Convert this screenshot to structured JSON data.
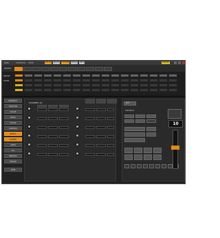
{
  "window": {
    "title": "GMA",
    "menus": [
      "CONTROL",
      "VIEW"
    ],
    "toolbar": [
      {
        "label": "SETUP",
        "active": true
      },
      {
        "label": "PATCH",
        "active": false
      },
      {
        "label": "FIXTURE",
        "active": true
      },
      {
        "label": "TOOLS",
        "active": false
      },
      {
        "label": "HELP",
        "active": false
      }
    ],
    "status": "ONLINE"
  },
  "strip": {
    "label": "PRESET",
    "tabs": [
      "1",
      "2",
      "3",
      "4",
      "5",
      "6",
      "7",
      "8",
      "9",
      "10",
      "11"
    ]
  },
  "grid": {
    "row_labels": [
      "PRESET",
      "FADER"
    ]
  },
  "sidebar": {
    "items": [
      {
        "label": "INTENSITY",
        "active": false
      },
      {
        "label": "POSITION",
        "active": false
      },
      {
        "label": "COLOR",
        "active": false
      },
      {
        "label": "BEAM",
        "active": false
      },
      {
        "label": "FOCUS",
        "active": false
      },
      {
        "label": "CONTROL",
        "active": false
      },
      {
        "label": "EFFECT",
        "active": true
      },
      {
        "label": "SHAPER",
        "active": true
      },
      {
        "label": "VIDEO",
        "active": false
      },
      {
        "label": "ALL",
        "active": false
      },
      {
        "label": "PRESETS",
        "active": false
      },
      {
        "label": "MACRO",
        "active": false
      },
      {
        "label": "VIEW",
        "active": false
      }
    ]
  },
  "panel": {
    "title": "CHANNEL 16"
  },
  "right": {
    "title": "EDIT",
    "section": "CONTROLS",
    "readout": "10",
    "fader_level": 0.55
  }
}
